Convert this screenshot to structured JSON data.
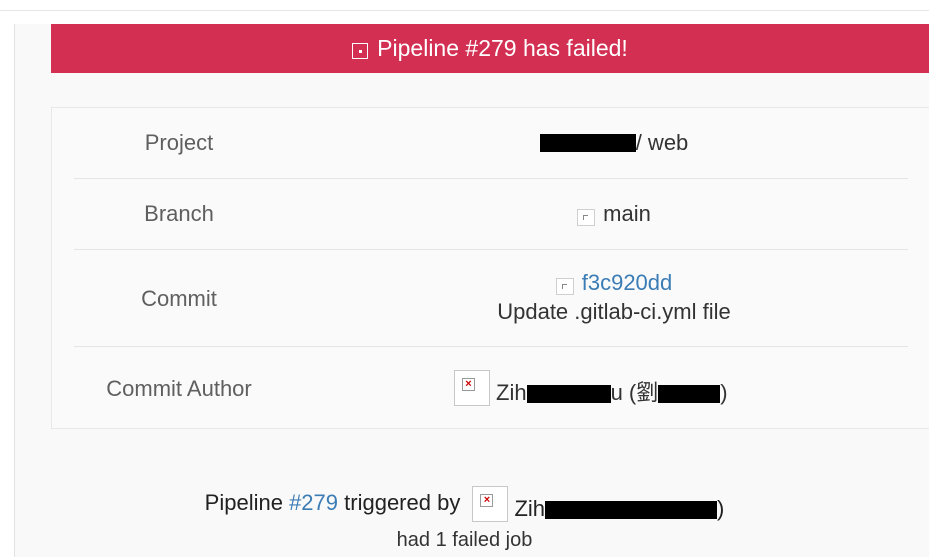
{
  "banner": {
    "icon": "broken-image-icon",
    "title": "Pipeline #279 has failed!",
    "color": "#d22f53"
  },
  "details": {
    "project": {
      "label": "Project",
      "value_suffix": "/ web"
    },
    "branch": {
      "label": "Branch",
      "icon": "branch-icon",
      "value": "main"
    },
    "commit": {
      "label": "Commit",
      "icon": "commit-icon",
      "sha": "f3c920dd",
      "message": "Update .gitlab-ci.yml file"
    },
    "author": {
      "label": "Commit Author",
      "avatar_icon": "broken-image-icon",
      "name_prefix": "Zih",
      "name_mid": "u (劉",
      "name_suffix": ")"
    }
  },
  "footer": {
    "line1_prefix": "Pipeline",
    "pipeline_link": "#279",
    "line1_mid": "triggered by",
    "trigger_name_prefix": "Zih",
    "trigger_name_suffix": ")",
    "line2": "had 1 failed job"
  },
  "colors": {
    "link": "#3b7cb5"
  }
}
